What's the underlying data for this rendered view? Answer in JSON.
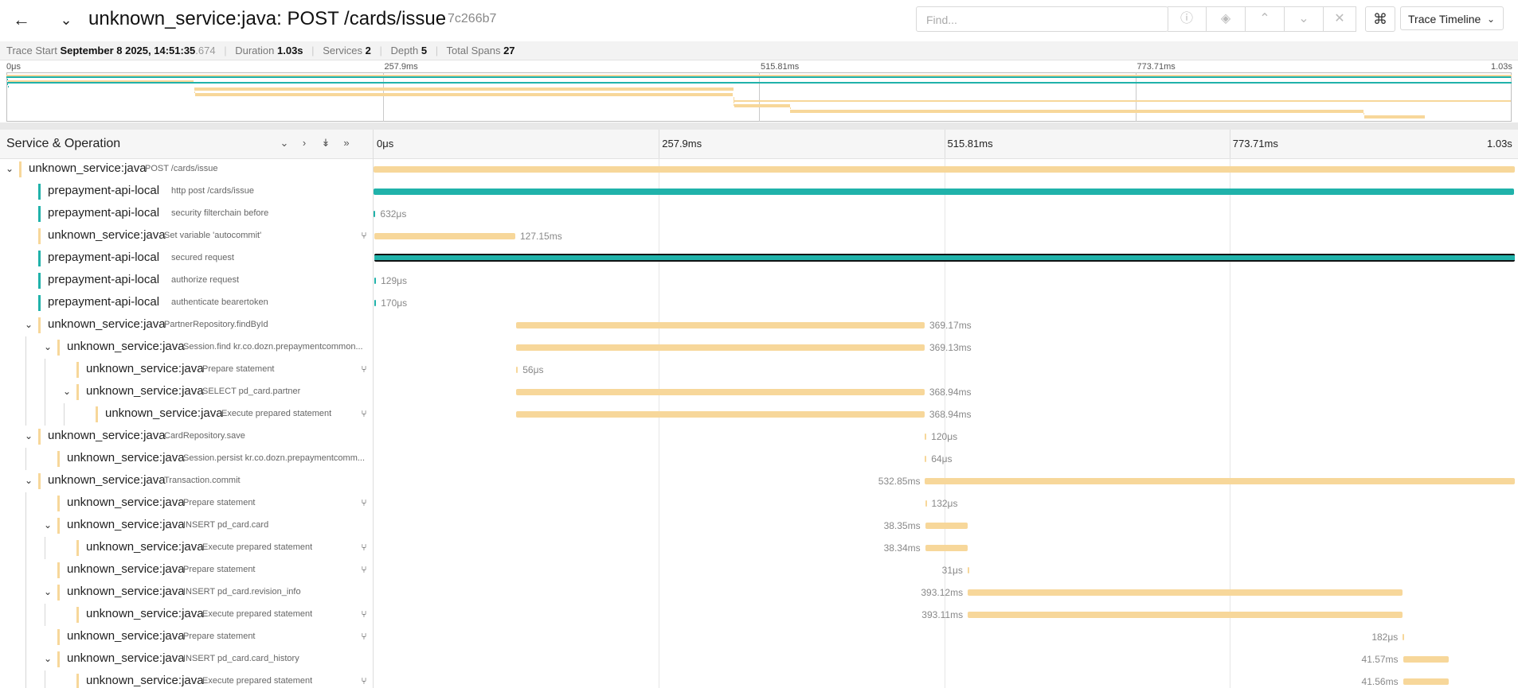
{
  "header": {
    "title": "unknown_service:java: POST /cards/issue",
    "trace_id": "7c266b7",
    "find_placeholder": "Find...",
    "view_select": "Trace Timeline",
    "icons": {
      "back": "arrow-left-icon",
      "collapse": "chevron-down-icon",
      "help": "help-circle-icon",
      "locate": "locate-icon",
      "prev": "chevron-up-icon",
      "next": "chevron-down-icon",
      "clear": "close-icon",
      "shortcuts": "command-icon"
    }
  },
  "summary": {
    "trace_start_label": "Trace Start",
    "trace_start_value": "September 8 2025, 14:51:35",
    "trace_start_ms": ".674",
    "duration_label": "Duration",
    "duration_value": "1.03s",
    "services_label": "Services",
    "services_value": "2",
    "depth_label": "Depth",
    "depth_value": "5",
    "total_spans_label": "Total Spans",
    "total_spans_value": "27"
  },
  "timeline": {
    "column_title": "Service & Operation",
    "total_ms": 1031.62,
    "ticks": [
      "0μs",
      "257.9ms",
      "515.81ms",
      "773.71ms",
      "1.03s"
    ],
    "colors": {
      "unknown_service:java": "#f7d79a",
      "prepayment-api-local": "#20b2aa"
    }
  },
  "spans": [
    {
      "service": "unknown_service:java",
      "op": "POST /cards/issue",
      "depth": 0,
      "toggle": true,
      "start": 0,
      "dur": 1031.62,
      "label": "",
      "fork": false
    },
    {
      "service": "prepayment-api-local",
      "op": "http post /cards/issue",
      "depth": 1,
      "toggle": false,
      "start": 0,
      "dur": 1031.2,
      "label": "",
      "fork": false
    },
    {
      "service": "prepayment-api-local",
      "op": "security filterchain before",
      "depth": 1,
      "toggle": false,
      "start": 0.3,
      "dur": 0.632,
      "label": "632μs",
      "fork": false
    },
    {
      "service": "unknown_service:java",
      "op": "Set variable 'autocommit'",
      "depth": 1,
      "toggle": false,
      "start": 1.0,
      "dur": 127.15,
      "label": "127.15ms",
      "fork": true
    },
    {
      "service": "prepayment-api-local",
      "op": "secured request",
      "depth": 1,
      "toggle": false,
      "start": 0.5,
      "dur": 1031.0,
      "label": "",
      "fork": false,
      "selected": true
    },
    {
      "service": "prepayment-api-local",
      "op": "authorize request",
      "depth": 1,
      "toggle": false,
      "start": 0.8,
      "dur": 0.129,
      "label": "129μs",
      "fork": false
    },
    {
      "service": "prepayment-api-local",
      "op": "authenticate bearertoken",
      "depth": 1,
      "toggle": false,
      "start": 0.9,
      "dur": 0.17,
      "label": "170μs",
      "fork": false
    },
    {
      "service": "unknown_service:java",
      "op": "PartnerRepository.findById",
      "depth": 1,
      "toggle": true,
      "start": 129.0,
      "dur": 369.17,
      "label": "369.17ms",
      "fork": false
    },
    {
      "service": "unknown_service:java",
      "op": "Session.find kr.co.dozn.prepaymentcommon...",
      "depth": 2,
      "toggle": true,
      "start": 129.02,
      "dur": 369.13,
      "label": "369.13ms",
      "fork": false
    },
    {
      "service": "unknown_service:java",
      "op": "Prepare statement",
      "depth": 3,
      "toggle": false,
      "start": 129.05,
      "dur": 0.056,
      "label": "56μs",
      "fork": true
    },
    {
      "service": "unknown_service:java",
      "op": "SELECT pd_card.partner",
      "depth": 3,
      "toggle": true,
      "start": 129.1,
      "dur": 368.94,
      "label": "368.94ms",
      "fork": false
    },
    {
      "service": "unknown_service:java",
      "op": "Execute prepared statement",
      "depth": 4,
      "toggle": false,
      "start": 129.12,
      "dur": 368.94,
      "label": "368.94ms",
      "fork": true
    },
    {
      "service": "unknown_service:java",
      "op": "CardRepository.save",
      "depth": 1,
      "toggle": true,
      "start": 498.3,
      "dur": 0.12,
      "label": "120μs",
      "fork": false
    },
    {
      "service": "unknown_service:java",
      "op": "Session.persist kr.co.dozn.prepaymentcomm...",
      "depth": 2,
      "toggle": false,
      "start": 498.35,
      "dur": 0.064,
      "label": "64μs",
      "fork": false
    },
    {
      "service": "unknown_service:java",
      "op": "Transaction.commit",
      "depth": 1,
      "toggle": true,
      "start": 498.5,
      "dur": 532.85,
      "label": "532.85ms",
      "fork": false,
      "label_left": true
    },
    {
      "service": "unknown_service:java",
      "op": "Prepare statement",
      "depth": 2,
      "toggle": false,
      "start": 498.55,
      "dur": 0.132,
      "label": "132μs",
      "fork": true
    },
    {
      "service": "unknown_service:java",
      "op": "INSERT pd_card.card",
      "depth": 2,
      "toggle": true,
      "start": 498.6,
      "dur": 38.35,
      "label": "38.35ms",
      "fork": false,
      "label_left": true
    },
    {
      "service": "unknown_service:java",
      "op": "Execute prepared statement",
      "depth": 3,
      "toggle": false,
      "start": 498.62,
      "dur": 38.34,
      "label": "38.34ms",
      "fork": true,
      "label_left": true
    },
    {
      "service": "unknown_service:java",
      "op": "Prepare statement",
      "depth": 2,
      "toggle": false,
      "start": 537.0,
      "dur": 0.031,
      "label": "31μs",
      "fork": true,
      "label_left": true
    },
    {
      "service": "unknown_service:java",
      "op": "INSERT pd_card.revision_info",
      "depth": 2,
      "toggle": true,
      "start": 537.1,
      "dur": 393.12,
      "label": "393.12ms",
      "fork": false,
      "label_left": true
    },
    {
      "service": "unknown_service:java",
      "op": "Execute prepared statement",
      "depth": 3,
      "toggle": false,
      "start": 537.12,
      "dur": 393.11,
      "label": "393.11ms",
      "fork": true,
      "label_left": true
    },
    {
      "service": "unknown_service:java",
      "op": "Prepare statement",
      "depth": 2,
      "toggle": false,
      "start": 930.3,
      "dur": 0.182,
      "label": "182μs",
      "fork": true,
      "label_left": true
    },
    {
      "service": "unknown_service:java",
      "op": "INSERT pd_card.card_history",
      "depth": 2,
      "toggle": true,
      "start": 930.5,
      "dur": 41.57,
      "label": "41.57ms",
      "fork": false,
      "label_left": true
    },
    {
      "service": "unknown_service:java",
      "op": "Execute prepared statement",
      "depth": 3,
      "toggle": false,
      "start": 930.52,
      "dur": 41.56,
      "label": "41.56ms",
      "fork": true,
      "label_left": true
    }
  ]
}
